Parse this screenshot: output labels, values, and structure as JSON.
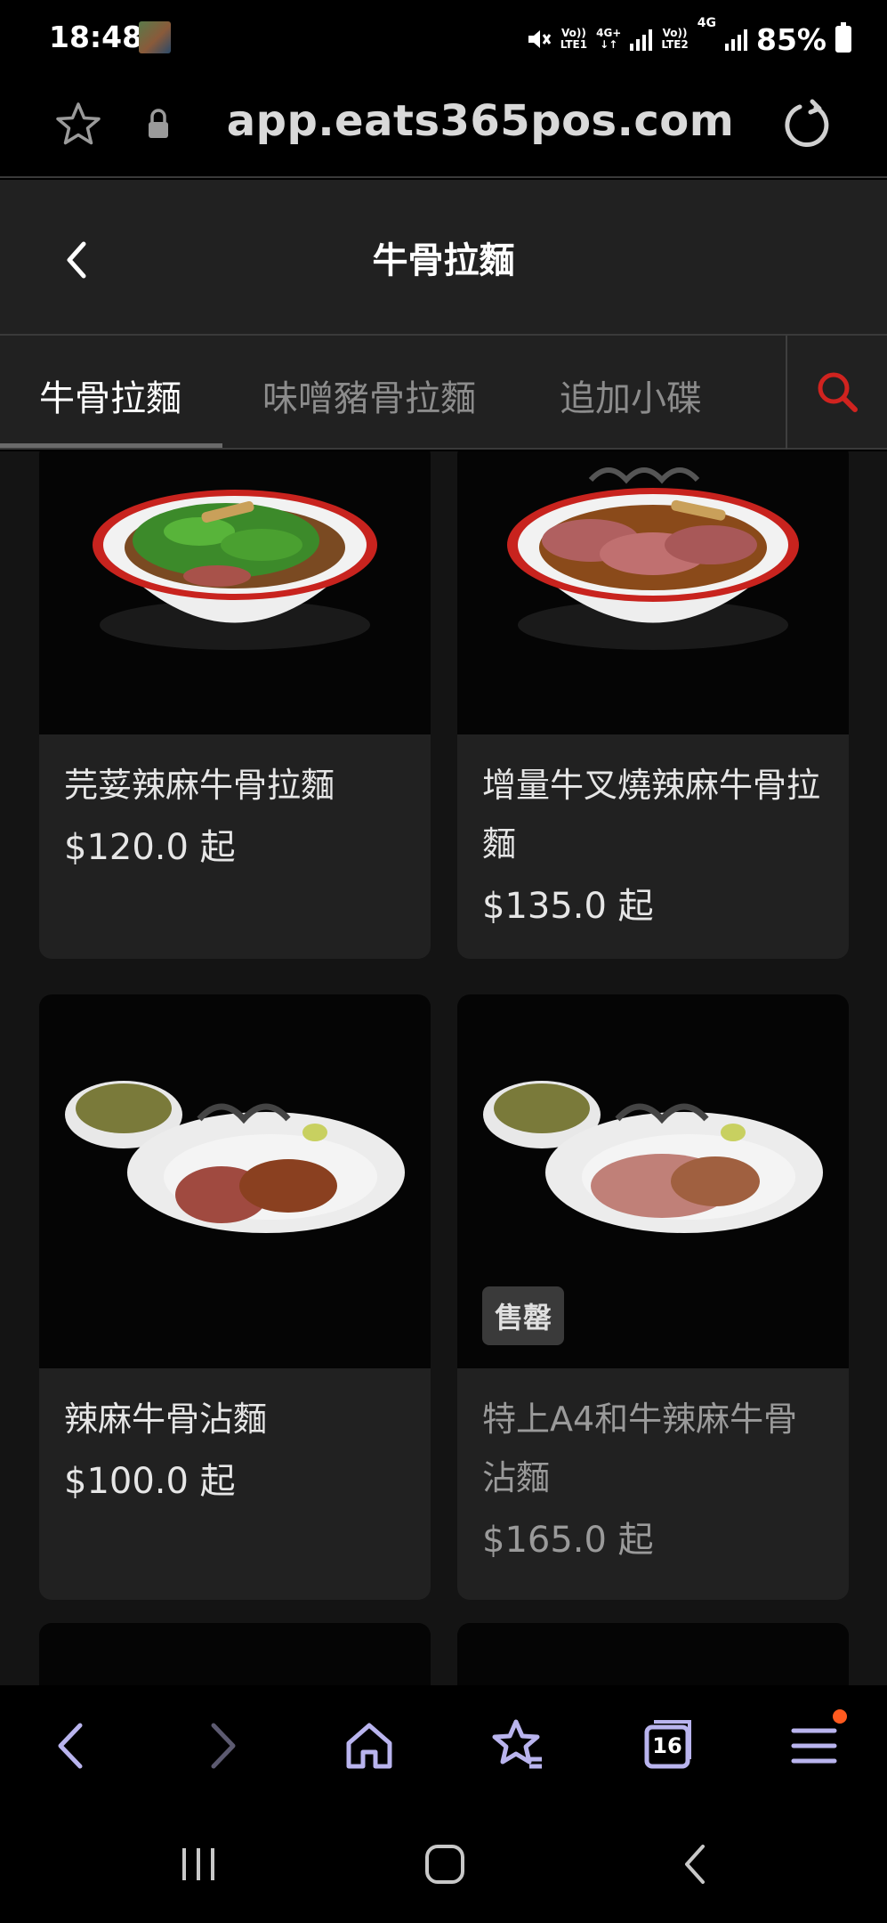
{
  "status_bar": {
    "time": "18:48",
    "sim1_label_top": "Vo))",
    "sim1_label_bottom": "LTE1",
    "net1_type": "4G+",
    "sim2_label_top": "Vo))",
    "sim2_label_bottom": "LTE2",
    "net2_type": "4G",
    "battery": "85%"
  },
  "browser": {
    "url": "app.eats365pos.com",
    "open_tabs": "16"
  },
  "page": {
    "title": "牛骨拉麵"
  },
  "tabs": [
    {
      "label": "牛骨拉麵",
      "active": true
    },
    {
      "label": "味噌豬骨拉麵",
      "active": false
    },
    {
      "label": "追加小碟",
      "active": false
    }
  ],
  "products": [
    {
      "name": "芫荽辣麻牛骨拉麵",
      "price": "$120.0 起",
      "image": "ramen-with-coriander",
      "sold_out": false
    },
    {
      "name": "增量牛叉燒辣麻牛骨拉麵",
      "price": "$135.0 起",
      "image": "ramen-with-extra-beef",
      "sold_out": false
    },
    {
      "name": "辣麻牛骨沾麵",
      "price": "$100.0 起",
      "image": "dipping-noodles-beef",
      "sold_out": false
    },
    {
      "name": "特上A4和牛辣麻牛骨沾麵",
      "price": "$165.0 起",
      "image": "dipping-noodles-wagyu",
      "sold_out": true,
      "badge": "售罄"
    }
  ],
  "colors": {
    "background": "#141414",
    "card": "#212121",
    "header": "#212121",
    "accent_search": "#d0231f",
    "bowl_rim_red": "#c8231e",
    "notification_dot": "#ff5a1f",
    "toolbar_icon": "#b9b4ee"
  }
}
